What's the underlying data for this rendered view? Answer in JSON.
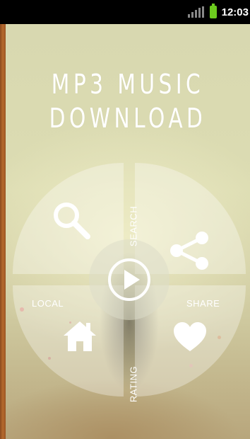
{
  "status_bar": {
    "time": "12:03",
    "icons": [
      "signal-icon",
      "battery-icon"
    ],
    "battery_color": "#6ccb1e"
  },
  "app": {
    "title_line1": "MP3 MUSIC",
    "title_line2": "DOWNLOAD"
  },
  "menu": {
    "search_label": "SEARCH",
    "local_label": "LOCAL",
    "share_label": "SHARE",
    "rating_label": "RATING",
    "icons": [
      "search-icon",
      "share-icon",
      "play-icon",
      "home-icon",
      "heart-icon"
    ]
  }
}
